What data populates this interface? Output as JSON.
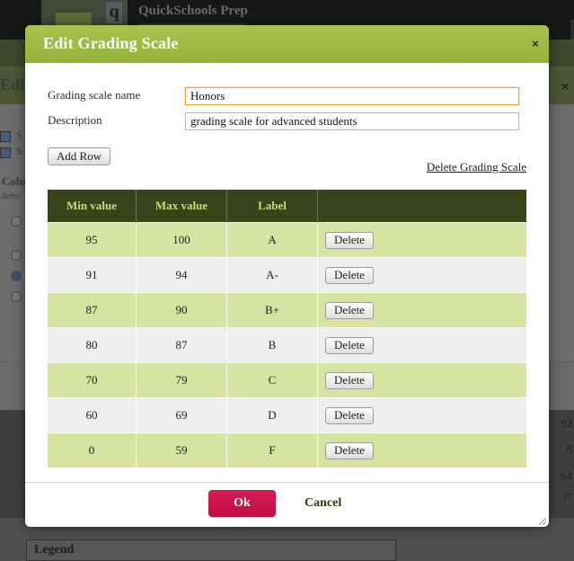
{
  "background": {
    "school_name": "QuickSchools Prep",
    "logo_letter": "q",
    "panel_title": "Edi",
    "close_glyph": "×",
    "checkbox_labels": [
      "S",
      "S"
    ],
    "column_label": "Colu",
    "column_sublabel": "Selec",
    "right_numbers": [
      "93",
      "8",
      "S4",
      "77"
    ],
    "legend_title": "Legend"
  },
  "dialog": {
    "title": "Edit Grading Scale",
    "close_glyph": "×",
    "fields": {
      "name_label": "Grading scale name",
      "name_value": "Honors",
      "description_label": "Description",
      "description_value": "grading scale for advanced students"
    },
    "add_row_label": "Add Row",
    "delete_scale_label": "Delete Grading Scale",
    "table": {
      "headers": [
        "Min value",
        "Max value",
        "Label",
        ""
      ],
      "delete_label": "Delete",
      "rows": [
        {
          "min": "95",
          "max": "100",
          "label": "A"
        },
        {
          "min": "91",
          "max": "94",
          "label": "A-"
        },
        {
          "min": "87",
          "max": "90",
          "label": "B+"
        },
        {
          "min": "80",
          "max": "87",
          "label": "B"
        },
        {
          "min": "70",
          "max": "79",
          "label": "C"
        },
        {
          "min": "60",
          "max": "69",
          "label": "D"
        },
        {
          "min": "0",
          "max": "59",
          "label": "F"
        }
      ]
    },
    "ok_label": "Ok",
    "cancel_label": "Cancel"
  },
  "colors": {
    "header_green": "#9cb842",
    "table_header": "#3a441b",
    "row_green": "#d6e4a2",
    "row_gray": "#efefef",
    "ok_button": "#c8134b"
  }
}
